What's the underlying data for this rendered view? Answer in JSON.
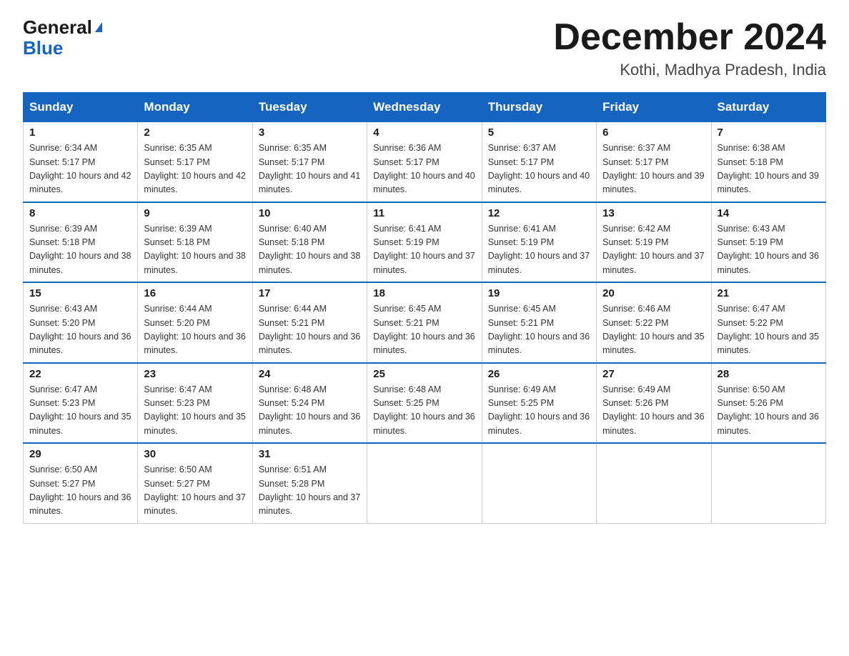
{
  "header": {
    "logo_general": "General",
    "logo_blue": "Blue",
    "month_title": "December 2024",
    "location": "Kothi, Madhya Pradesh, India"
  },
  "weekdays": [
    "Sunday",
    "Monday",
    "Tuesday",
    "Wednesday",
    "Thursday",
    "Friday",
    "Saturday"
  ],
  "weeks": [
    [
      {
        "day": "1",
        "sunrise": "6:34 AM",
        "sunset": "5:17 PM",
        "daylight": "10 hours and 42 minutes."
      },
      {
        "day": "2",
        "sunrise": "6:35 AM",
        "sunset": "5:17 PM",
        "daylight": "10 hours and 42 minutes."
      },
      {
        "day": "3",
        "sunrise": "6:35 AM",
        "sunset": "5:17 PM",
        "daylight": "10 hours and 41 minutes."
      },
      {
        "day": "4",
        "sunrise": "6:36 AM",
        "sunset": "5:17 PM",
        "daylight": "10 hours and 40 minutes."
      },
      {
        "day": "5",
        "sunrise": "6:37 AM",
        "sunset": "5:17 PM",
        "daylight": "10 hours and 40 minutes."
      },
      {
        "day": "6",
        "sunrise": "6:37 AM",
        "sunset": "5:17 PM",
        "daylight": "10 hours and 39 minutes."
      },
      {
        "day": "7",
        "sunrise": "6:38 AM",
        "sunset": "5:18 PM",
        "daylight": "10 hours and 39 minutes."
      }
    ],
    [
      {
        "day": "8",
        "sunrise": "6:39 AM",
        "sunset": "5:18 PM",
        "daylight": "10 hours and 38 minutes."
      },
      {
        "day": "9",
        "sunrise": "6:39 AM",
        "sunset": "5:18 PM",
        "daylight": "10 hours and 38 minutes."
      },
      {
        "day": "10",
        "sunrise": "6:40 AM",
        "sunset": "5:18 PM",
        "daylight": "10 hours and 38 minutes."
      },
      {
        "day": "11",
        "sunrise": "6:41 AM",
        "sunset": "5:19 PM",
        "daylight": "10 hours and 37 minutes."
      },
      {
        "day": "12",
        "sunrise": "6:41 AM",
        "sunset": "5:19 PM",
        "daylight": "10 hours and 37 minutes."
      },
      {
        "day": "13",
        "sunrise": "6:42 AM",
        "sunset": "5:19 PM",
        "daylight": "10 hours and 37 minutes."
      },
      {
        "day": "14",
        "sunrise": "6:43 AM",
        "sunset": "5:19 PM",
        "daylight": "10 hours and 36 minutes."
      }
    ],
    [
      {
        "day": "15",
        "sunrise": "6:43 AM",
        "sunset": "5:20 PM",
        "daylight": "10 hours and 36 minutes."
      },
      {
        "day": "16",
        "sunrise": "6:44 AM",
        "sunset": "5:20 PM",
        "daylight": "10 hours and 36 minutes."
      },
      {
        "day": "17",
        "sunrise": "6:44 AM",
        "sunset": "5:21 PM",
        "daylight": "10 hours and 36 minutes."
      },
      {
        "day": "18",
        "sunrise": "6:45 AM",
        "sunset": "5:21 PM",
        "daylight": "10 hours and 36 minutes."
      },
      {
        "day": "19",
        "sunrise": "6:45 AM",
        "sunset": "5:21 PM",
        "daylight": "10 hours and 36 minutes."
      },
      {
        "day": "20",
        "sunrise": "6:46 AM",
        "sunset": "5:22 PM",
        "daylight": "10 hours and 35 minutes."
      },
      {
        "day": "21",
        "sunrise": "6:47 AM",
        "sunset": "5:22 PM",
        "daylight": "10 hours and 35 minutes."
      }
    ],
    [
      {
        "day": "22",
        "sunrise": "6:47 AM",
        "sunset": "5:23 PM",
        "daylight": "10 hours and 35 minutes."
      },
      {
        "day": "23",
        "sunrise": "6:47 AM",
        "sunset": "5:23 PM",
        "daylight": "10 hours and 35 minutes."
      },
      {
        "day": "24",
        "sunrise": "6:48 AM",
        "sunset": "5:24 PM",
        "daylight": "10 hours and 36 minutes."
      },
      {
        "day": "25",
        "sunrise": "6:48 AM",
        "sunset": "5:25 PM",
        "daylight": "10 hours and 36 minutes."
      },
      {
        "day": "26",
        "sunrise": "6:49 AM",
        "sunset": "5:25 PM",
        "daylight": "10 hours and 36 minutes."
      },
      {
        "day": "27",
        "sunrise": "6:49 AM",
        "sunset": "5:26 PM",
        "daylight": "10 hours and 36 minutes."
      },
      {
        "day": "28",
        "sunrise": "6:50 AM",
        "sunset": "5:26 PM",
        "daylight": "10 hours and 36 minutes."
      }
    ],
    [
      {
        "day": "29",
        "sunrise": "6:50 AM",
        "sunset": "5:27 PM",
        "daylight": "10 hours and 36 minutes."
      },
      {
        "day": "30",
        "sunrise": "6:50 AM",
        "sunset": "5:27 PM",
        "daylight": "10 hours and 37 minutes."
      },
      {
        "day": "31",
        "sunrise": "6:51 AM",
        "sunset": "5:28 PM",
        "daylight": "10 hours and 37 minutes."
      },
      null,
      null,
      null,
      null
    ]
  ]
}
